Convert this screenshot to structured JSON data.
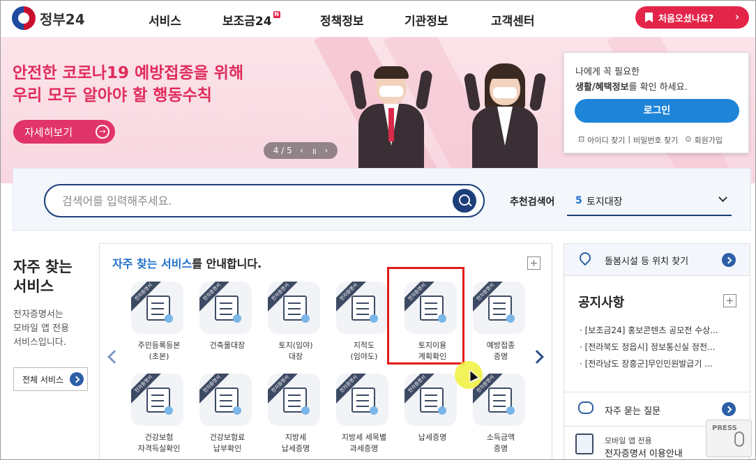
{
  "header": {
    "logo_text": "정부24",
    "nav": [
      "서비스",
      "보조금24",
      "정책정보",
      "기관정보",
      "고객센터"
    ],
    "new_badge": "N",
    "first_visit_label": "처음오셨나요?"
  },
  "banner": {
    "title": "안전한 코로나19 예방접종을 위해\n우리 모두 알아야 할 행동수칙",
    "more_label": "자세히보기",
    "pager": {
      "current": "4",
      "total": "5",
      "text": "4 / 5"
    }
  },
  "login_box": {
    "line1": "나에게 꼭 필요한",
    "line2_bold": "생활/혜택정보",
    "line2_rest": "를 확인 하세요.",
    "login_label": "로그인",
    "links": [
      "아이디 찾기",
      "비밀번호 찾기",
      "회원가입"
    ]
  },
  "search": {
    "placeholder": "검색어를 입력해주세요.",
    "recommend_label": "추천검색어",
    "recommend_rank": "5",
    "recommend_text": "토지대장"
  },
  "frequent": {
    "title": "자주 찾는\n서비스",
    "desc": "전자증명서는\n모바일 앱 전용\n서비스입니다.",
    "all_label": "전체 서비스",
    "panel_title_hl": "자주 찾는 서비스",
    "panel_title_rest": "를 안내합니다.",
    "ribbon": "전자증명서",
    "services": [
      {
        "label": "주민등록등본\n(초본)",
        "icon": "id-card-icon"
      },
      {
        "label": "건축물대장",
        "icon": "receipt-search-icon"
      },
      {
        "label": "토지(임야)\n대장",
        "icon": "land-chat-icon"
      },
      {
        "label": "지적도\n(임야도)",
        "icon": "map-compass-icon"
      },
      {
        "label": "토지이용\n계획확인",
        "icon": "map-pin-icon"
      },
      {
        "label": "예방접종\n증명",
        "icon": "syringe-doc-icon"
      },
      {
        "label": "건강보험\n자격득실확인",
        "icon": "checklist-icon"
      },
      {
        "label": "건강보험료\n납부확인",
        "icon": "clipboard-check-icon"
      },
      {
        "label": "지방세\n납세증명",
        "icon": "document-icon"
      },
      {
        "label": "지방세 세목별\n과세증명",
        "icon": "chart-board-icon"
      },
      {
        "label": "납세증명",
        "icon": "coin-doc-icon"
      },
      {
        "label": "소득금액\n증명",
        "icon": "coin-stack-icon"
      }
    ]
  },
  "right": {
    "care_label": "돌봄시설 등 위치 찾기",
    "notice_title": "공지사항",
    "notices": [
      "· [보조금24] 홍보콘텐츠 공모전 수상...",
      "· [전라북도 정읍시] 정보통신실 정전...",
      "· [전라남도 장흥군]무인민원발급기 ..."
    ],
    "faq_label": "자주 묻는 질문",
    "mobile_line1": "모바일 앱 전용",
    "mobile_line2": "전자증명서 이용안내"
  },
  "press_label": "PRESS",
  "colors": {
    "accent": "#e4254a",
    "navy": "#1c3f7b",
    "blue": "#1e84d8",
    "highlight": "#e01a1a"
  }
}
